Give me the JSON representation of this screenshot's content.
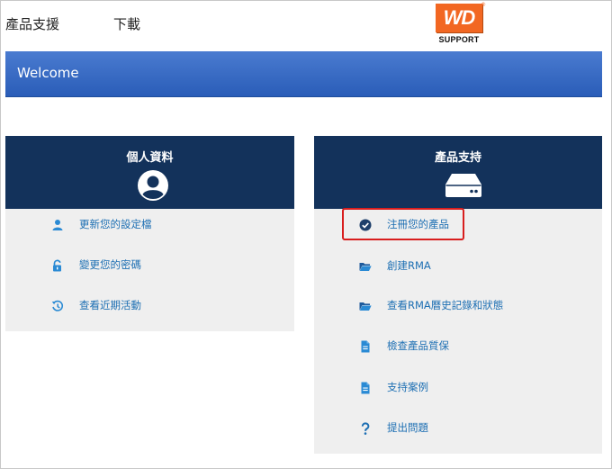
{
  "nav": {
    "support_label": "產品支援",
    "download_label": "下載"
  },
  "logo": {
    "mark": "WD",
    "registered": "®",
    "sub": "SUPPORT"
  },
  "banner": {
    "title": "Welcome"
  },
  "profile_card": {
    "title": "個人資料",
    "icon": "user-avatar-icon",
    "items": [
      {
        "label": "更新您的設定檔",
        "icon": "person-icon"
      },
      {
        "label": "變更您的密碼",
        "icon": "unlock-icon"
      },
      {
        "label": "查看近期活動",
        "icon": "history-icon"
      }
    ]
  },
  "support_card": {
    "title": "產品支持",
    "icon": "drive-icon",
    "items": [
      {
        "label": "注冊您的產品",
        "icon": "check-circle-icon"
      },
      {
        "label": "創建RMA",
        "icon": "folder-open-icon"
      },
      {
        "label": "查看RMA曆史記錄和狀態",
        "icon": "folder-open-icon"
      },
      {
        "label": "檢查產品質保",
        "icon": "document-icon"
      },
      {
        "label": "支持案例",
        "icon": "document-icon"
      },
      {
        "label": "提出問題",
        "icon": "question-icon"
      }
    ]
  },
  "colors": {
    "header_navy": "#13325b",
    "banner_blue": "#3a6cc4",
    "link_blue": "#1d6fb3",
    "icon_navy": "#1e3f6b",
    "icon_blue": "#2a8ad4",
    "highlight_red": "#d81e1e",
    "logo_orange": "#f26722"
  }
}
